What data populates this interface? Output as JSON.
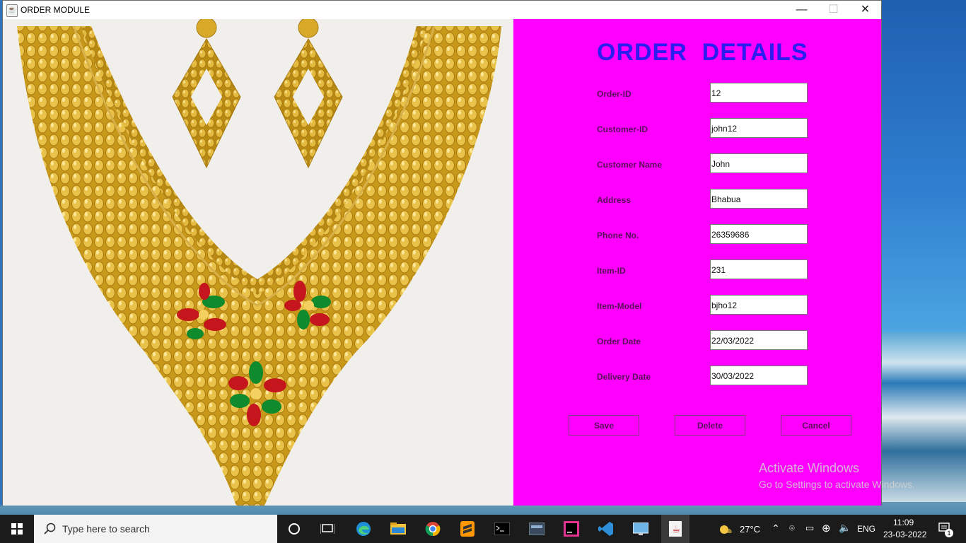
{
  "window": {
    "title": "ORDER MODULE",
    "controls": {
      "minimize": "—",
      "maximize": "☐",
      "close": "✕"
    }
  },
  "form": {
    "heading": "ORDER  DETAILS",
    "fields": [
      {
        "label": "Order-ID",
        "value": "12"
      },
      {
        "label": "Customer-ID",
        "value": "john12"
      },
      {
        "label": "Customer Name",
        "value": "John"
      },
      {
        "label": "Address",
        "value": "Bhabua"
      },
      {
        "label": "Phone No.",
        "value": "26359686"
      },
      {
        "label": "Item-ID",
        "value": "231"
      },
      {
        "label": "Item-Model",
        "value": "bjho12"
      },
      {
        "label": "Order Date",
        "value": "22/03/2022"
      },
      {
        "label": "Delivery Date",
        "value": "30/03/2022"
      }
    ],
    "buttons": {
      "save": "Save",
      "delete": "Delete",
      "cancel": "Cancel"
    }
  },
  "watermark": {
    "line1": "Activate Windows",
    "line2": "Go to Settings to activate Windows."
  },
  "taskbar": {
    "search_placeholder": "Type here to search",
    "weather": "27°C",
    "language": "ENG",
    "time": "11:09",
    "date": "23-03-2022",
    "notification_count": "1"
  },
  "colors": {
    "panel_bg": "#ff00ff",
    "heading": "#2d1cf0",
    "label": "#5b0f5b",
    "taskbar": "#1b1b1b"
  }
}
